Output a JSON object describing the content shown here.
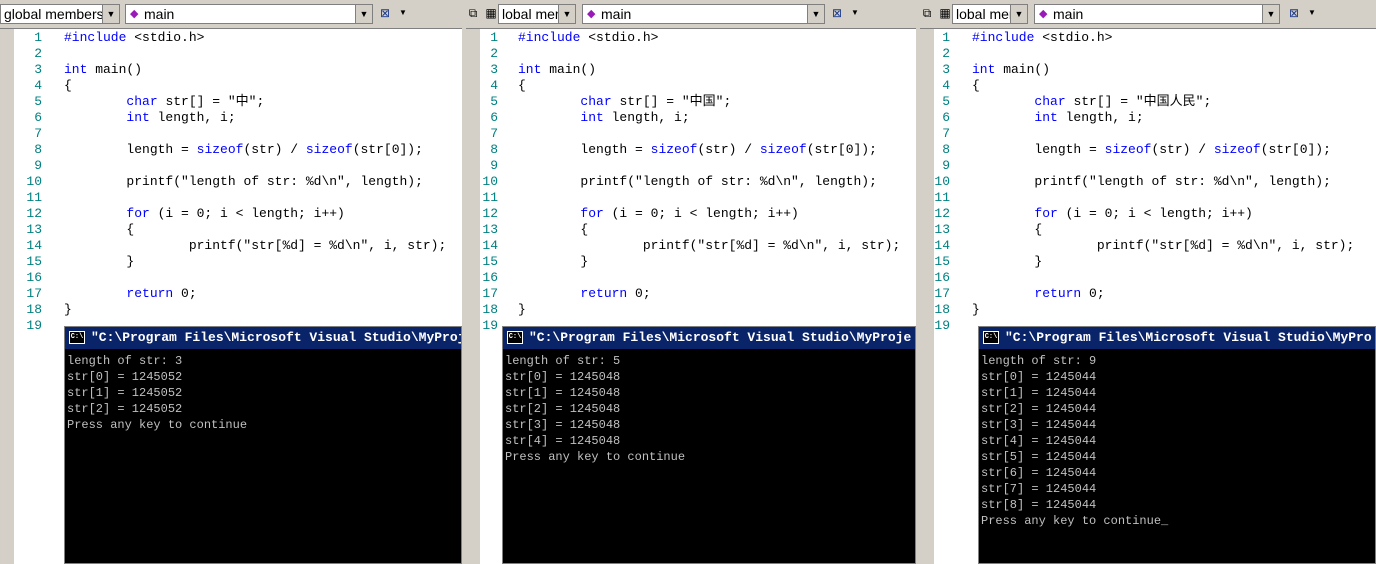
{
  "toolbar": {
    "scope": "global members",
    "scope_cropped": "lobal members",
    "function": "main"
  },
  "line_numbers": [
    "1",
    "2",
    "3",
    "4",
    "5",
    "6",
    "7",
    "8",
    "9",
    "10",
    "11",
    "12",
    "13",
    "14",
    "15",
    "16",
    "17",
    "18",
    "19"
  ],
  "panels": [
    {
      "string_literal": "\"中\"",
      "console_title": "\"C:\\Program Files\\Microsoft Visual Studio\\MyProj",
      "output": [
        "length of str: 3",
        "str[0] = 1245052",
        "str[1] = 1245052",
        "str[2] = 1245052",
        "Press any key to continue"
      ]
    },
    {
      "string_literal": "\"中国\"",
      "console_title": "\"C:\\Program Files\\Microsoft Visual Studio\\MyProje",
      "output": [
        "length of str: 5",
        "str[0] = 1245048",
        "str[1] = 1245048",
        "str[2] = 1245048",
        "str[3] = 1245048",
        "str[4] = 1245048",
        "Press any key to continue"
      ]
    },
    {
      "string_literal": "\"中国人民\"",
      "console_title": "\"C:\\Program Files\\Microsoft Visual Studio\\MyPro",
      "output": [
        "length of str: 9",
        "str[0] = 1245044",
        "str[1] = 1245044",
        "str[2] = 1245044",
        "str[3] = 1245044",
        "str[4] = 1245044",
        "str[5] = 1245044",
        "str[6] = 1245044",
        "str[7] = 1245044",
        "str[8] = 1245044",
        "Press any key to continue_"
      ]
    }
  ],
  "code": {
    "l1_kw": "#include",
    "l1_rest": " <stdio.h>",
    "l3_kw": "int",
    "l3_rest": " main()",
    "l4": "{",
    "l5_kw": "char",
    "l5_rest": " str[] = ",
    "l5_end": ";",
    "l6_kw": "int",
    "l6_rest": " length, i;",
    "l8_a": "length = ",
    "l8_kw1": "sizeof",
    "l8_b": "(str) / ",
    "l8_kw2": "sizeof",
    "l8_c": "(str[0]);",
    "l10": "printf(\"length of str: %d\\n\", length);",
    "l12_kw": "for",
    "l12_rest": " (i = 0; i < length; i++)",
    "l13": "{",
    "l14": "printf(\"str[%d] = %d\\n\", i, str);",
    "l15": "}",
    "l17_kw": "return",
    "l17_rest": " 0;",
    "l18": "}"
  },
  "icons": {
    "console": "cmd-icon",
    "wizard": "wizard-icon",
    "dropdown": "chevron-down-icon"
  }
}
